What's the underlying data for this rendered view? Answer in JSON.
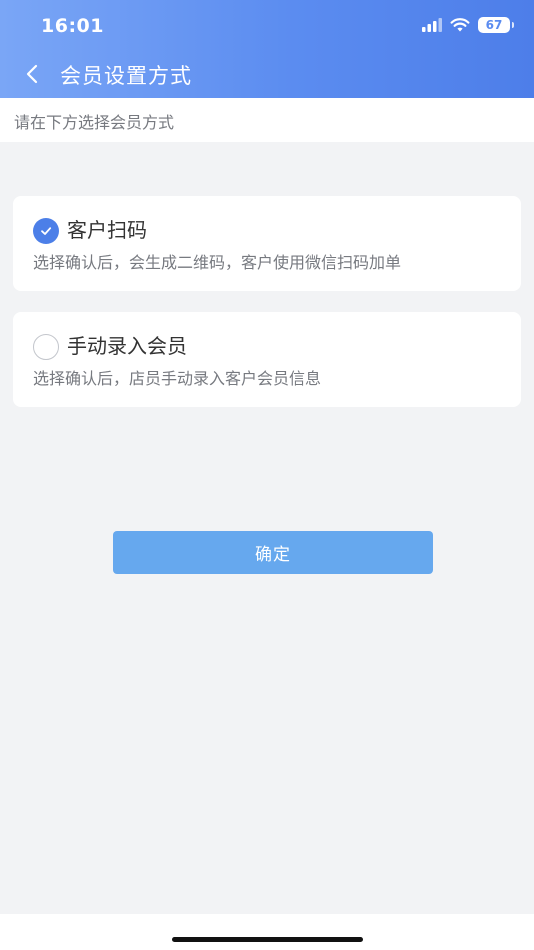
{
  "status_bar": {
    "time": "16:01",
    "battery": "67",
    "icons": [
      "signal-icon",
      "wifi-icon",
      "battery-icon"
    ]
  },
  "nav": {
    "back_icon": "chevron-left-icon",
    "title": "会员设置方式"
  },
  "subtitle": "请在下方选择会员方式",
  "options": [
    {
      "title": "客户扫码",
      "description": "选择确认后，会生成二维码，客户使用微信扫码加单",
      "selected": true
    },
    {
      "title": "手动录入会员",
      "description": "选择确认后，店员手动录入客户会员信息",
      "selected": false
    }
  ],
  "confirm_label": "确定",
  "colors": {
    "accent": "#4c7fe8",
    "header_start": "#7aa6f6",
    "header_end": "#4d7ee9",
    "button": "#66a8ee",
    "background": "#f2f3f5"
  }
}
